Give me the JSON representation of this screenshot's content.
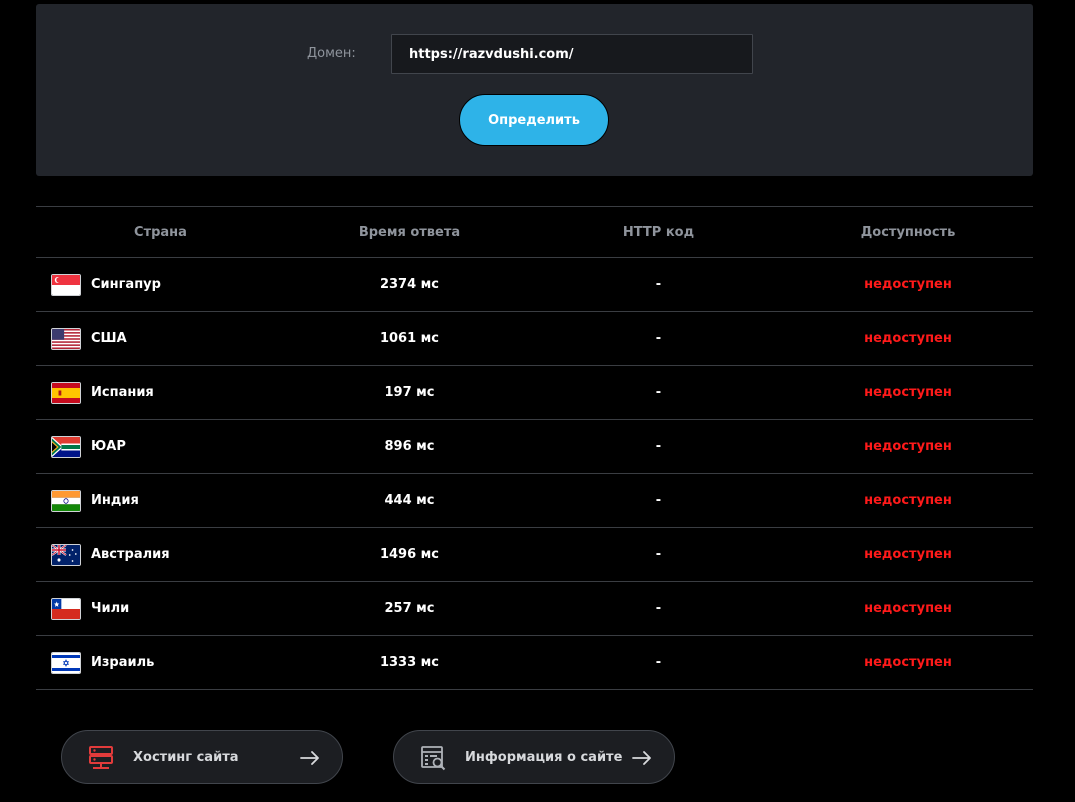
{
  "form": {
    "domain_label": "Домен:",
    "domain_value": "https://razvdushi.com/",
    "submit_label": "Определить"
  },
  "table": {
    "headers": {
      "country": "Страна",
      "time": "Время ответа",
      "code": "HTTP код",
      "status": "Доступность"
    },
    "rows": [
      {
        "flag": "singapore-flag-icon",
        "country": "Сингапур",
        "time": "2374 мс",
        "code": "-",
        "status": "недоступен"
      },
      {
        "flag": "usa-flag-icon",
        "country": "США",
        "time": "1061 мс",
        "code": "-",
        "status": "недоступен"
      },
      {
        "flag": "spain-flag-icon",
        "country": "Испания",
        "time": "197 мс",
        "code": "-",
        "status": "недоступен"
      },
      {
        "flag": "south-africa-flag-icon",
        "country": "ЮАР",
        "time": "896 мс",
        "code": "-",
        "status": "недоступен"
      },
      {
        "flag": "india-flag-icon",
        "country": "Индия",
        "time": "444 мс",
        "code": "-",
        "status": "недоступен"
      },
      {
        "flag": "australia-flag-icon",
        "country": "Австралия",
        "time": "1496 мс",
        "code": "-",
        "status": "недоступен"
      },
      {
        "flag": "chile-flag-icon",
        "country": "Чили",
        "time": "257 мс",
        "code": "-",
        "status": "недоступен"
      },
      {
        "flag": "israel-flag-icon",
        "country": "Израиль",
        "time": "1333 мс",
        "code": "-",
        "status": "недоступен"
      }
    ]
  },
  "actions": {
    "hosting_label": "Хостинг сайта",
    "info_label": "Информация о сайте"
  },
  "colors": {
    "accent": "#2eb3e8",
    "panel": "#22252b",
    "status_down": "#ff1a1a",
    "icon_red": "#e23b3b"
  }
}
